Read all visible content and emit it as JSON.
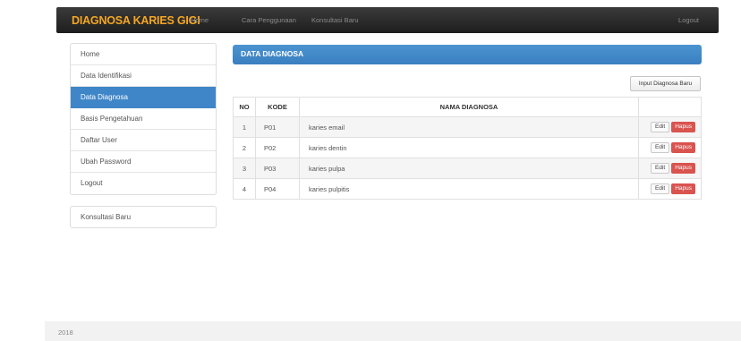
{
  "navbar": {
    "brand": "DIAGNOSA KARIES GIGI",
    "links": [
      "Home",
      "Cara Penggunaan",
      "Konsultasi Baru"
    ],
    "logout": "Logout"
  },
  "sidebar": {
    "items": [
      {
        "label": "Home"
      },
      {
        "label": "Data Identifikasi"
      },
      {
        "label": "Data Diagnosa",
        "active": true
      },
      {
        "label": "Basis Pengetahuan"
      },
      {
        "label": "Daftar User"
      },
      {
        "label": "Ubah Password"
      },
      {
        "label": "Logout"
      }
    ],
    "secondary": "Konsultasi Baru"
  },
  "main": {
    "title": "DATA DIAGNOSA",
    "new_button": "Input Diagnosa Baru",
    "table": {
      "headers": [
        "NO",
        "KODE",
        "NAMA DIAGNOSA",
        ""
      ],
      "rows": [
        {
          "no": "1",
          "kode": "P01",
          "nama": "karies email"
        },
        {
          "no": "2",
          "kode": "P02",
          "nama": "karies dentin"
        },
        {
          "no": "3",
          "kode": "P03",
          "nama": "karies pulpa"
        },
        {
          "no": "4",
          "kode": "P04",
          "nama": "karies pulpitis"
        }
      ],
      "edit_label": "Edit",
      "delete_label": "Hapus"
    }
  },
  "footer": {
    "text": "2018"
  },
  "colors": {
    "brand": "#f5a623",
    "accent": "#3f86c8",
    "danger": "#d9534f",
    "navbar": "#2a2a2a"
  }
}
